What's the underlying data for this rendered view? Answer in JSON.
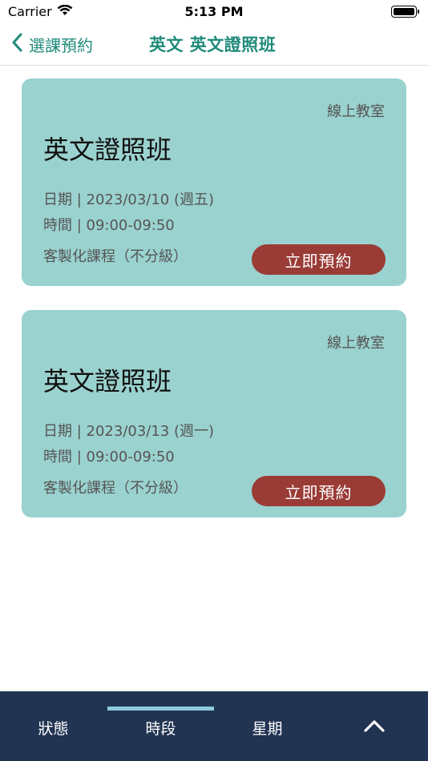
{
  "status_bar": {
    "carrier": "Carrier",
    "time": "5:13 PM"
  },
  "nav": {
    "back_label": "選課預約",
    "title": "英文 英文證照班"
  },
  "cards": [
    {
      "location": "線上教室",
      "title": "英文證照班",
      "date": "日期 | 2023/03/10 (週五)",
      "time": "時間 | 09:00-09:50",
      "type": "客製化課程（不分級）",
      "button": "立即預約"
    },
    {
      "location": "線上教室",
      "title": "英文證照班",
      "date": "日期 | 2023/03/13 (週一)",
      "time": "時間 | 09:00-09:50",
      "type": "客製化課程（不分級）",
      "button": "立即預約"
    }
  ],
  "tabs": [
    {
      "label": "狀態"
    },
    {
      "label": "時段"
    },
    {
      "label": "星期"
    }
  ],
  "colors": {
    "accent": "#1f8a7a",
    "card_bg": "#9ad2cf",
    "button_bg": "#9a3b36",
    "tab_bar_bg": "#213452",
    "tab_indicator": "#8fc9de"
  },
  "icons": {
    "wifi": "wifi-icon",
    "battery": "battery-icon",
    "back": "chevron-left-icon",
    "expand": "chevron-up-icon"
  },
  "active_tab": "時段"
}
